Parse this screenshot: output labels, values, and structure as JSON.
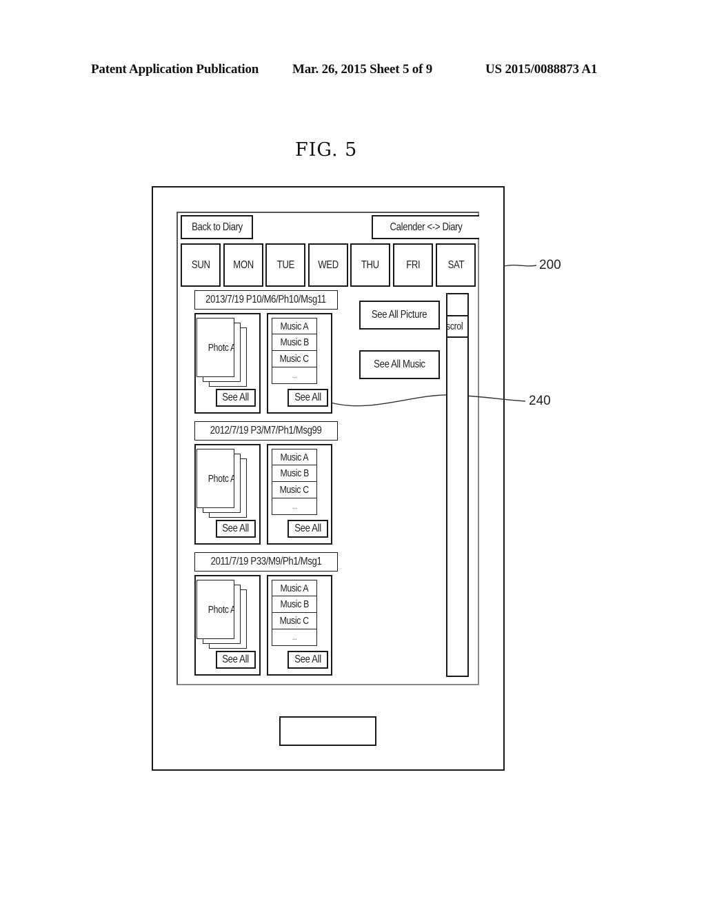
{
  "header": {
    "publication": "Patent Application Publication",
    "date_sheet": "Mar. 26, 2015  Sheet 5 of 9",
    "patent_number": "US 2015/0088873 A1"
  },
  "figure": {
    "label": "FIG.  5"
  },
  "reference_numerals": {
    "device": "200",
    "entry_area": "240"
  },
  "toolbar": {
    "back_label": "Back to Diary",
    "toggle_label": "Calender <-> Diary"
  },
  "weekdays": [
    "SUN",
    "MON",
    "TUE",
    "WED",
    "THU",
    "FRI",
    "SAT"
  ],
  "side_buttons": {
    "see_all_picture": "See All Picture",
    "see_all_music": "See All Music"
  },
  "scrollbar": {
    "thumb_label": "scrol",
    "position": 0.0
  },
  "entries": [
    {
      "summary": "2013/7/19 P10/M6/Ph10/Msg11",
      "photo_label": "Photc A",
      "music": [
        "Music A",
        "Music B",
        "Music C",
        "..."
      ],
      "photo_see_all": "See All",
      "music_see_all": "See All"
    },
    {
      "summary": "2012/7/19 P3/M7/Ph1/Msg99",
      "photo_label": "Photc A",
      "music": [
        "Music A",
        "Music B",
        "Music C",
        "..."
      ],
      "photo_see_all": "See All",
      "music_see_all": "See All"
    },
    {
      "summary": "2011/7/19 P33/M9/Ph1/Msg1",
      "photo_label": "Photc A",
      "music": [
        "Music A",
        "Music B",
        "Music C",
        "..."
      ],
      "photo_see_all": "See All",
      "music_see_all": "See All"
    }
  ]
}
